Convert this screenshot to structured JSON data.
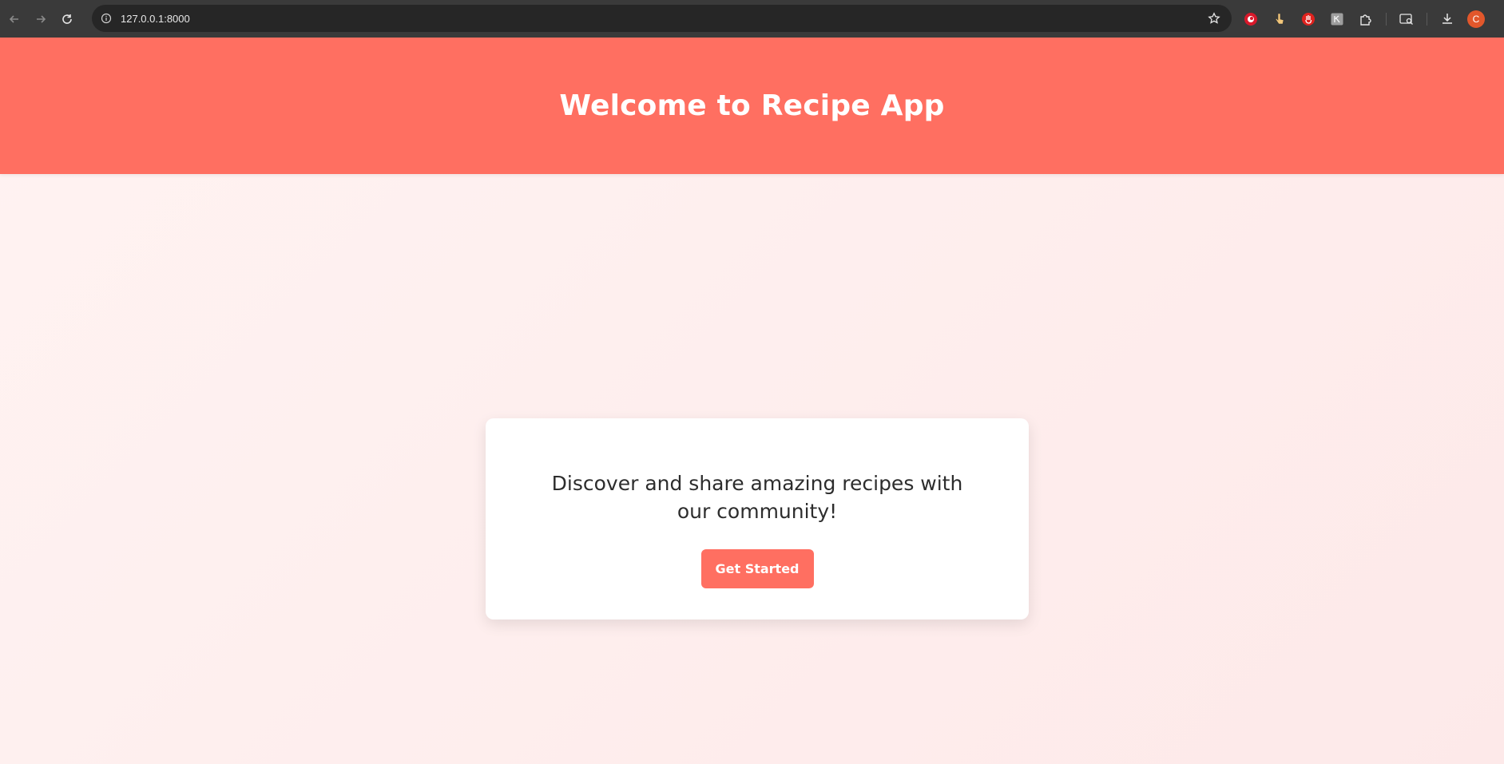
{
  "browser": {
    "url": "127.0.0.1:8000",
    "profile_initial": "C",
    "icons": {
      "back": "arrow-left-icon",
      "forward": "arrow-right-icon",
      "reload": "reload-icon",
      "site_info": "info-icon",
      "bookmark": "star-icon",
      "extensions": [
        "red-circle-extension-icon",
        "hand-pointer-extension-icon",
        "red-hand-extension-icon",
        "gray-box-extension-icon",
        "puzzle-icon"
      ],
      "tab_search": "tab-search-icon",
      "downloads": "download-icon"
    }
  },
  "header": {
    "title": "Welcome to Recipe App"
  },
  "hero": {
    "text": "Discover and share amazing recipes with our community!",
    "button_label": "Get Started"
  },
  "colors": {
    "accent": "#ff6f61",
    "page_background": "#fdeeee",
    "card_background": "#ffffff",
    "text": "#2d2d2d"
  }
}
